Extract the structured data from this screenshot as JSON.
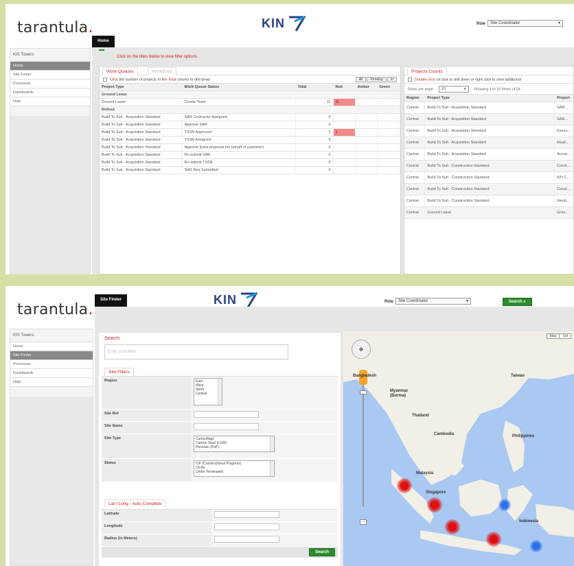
{
  "brand": {
    "logo": "tarantula",
    "logo_dot": ".",
    "kin": "KIN"
  },
  "screen1": {
    "role_label": "Role",
    "role_value": "Site Coordinator",
    "tab": "Home",
    "sidebar": {
      "title": "KIS Towers",
      "items": [
        "Home",
        "Site Finder",
        "Processes",
        "Dashboards",
        "Help"
      ]
    },
    "hint": "Click on the titles below to view filter options.",
    "work_queues": {
      "tabs": [
        "Work Queues",
        "Workflows"
      ],
      "note_prefix": "Click",
      "note_mid": " the number of projects in the ",
      "note_red": "Total",
      "note_suffix": " column to drill down",
      "buttons": [
        "All",
        "Pending",
        "In"
      ],
      "columns": [
        "Project Type",
        "Work Queue Status",
        "Total",
        "Red",
        "Amber",
        "Green"
      ],
      "groups": [
        {
          "name": "Ground Lease",
          "rows": [
            [
              "Ground Lease",
              "Create Team",
              "11",
              "11",
              "",
              ""
            ]
          ]
        },
        {
          "name": "Rollout",
          "rows": [
            [
              "Build To Suit - Acquisition Standard",
              "SAR Contractor Assigned",
              "0",
              "",
              "",
              ""
            ],
            [
              "Build To Suit - Acquisition Standard",
              "Approve SAR",
              "0",
              "",
              "",
              ""
            ],
            [
              "Build To Suit - Acquisition Standard",
              "TSSR Approved",
              "1",
              "1",
              "",
              ""
            ],
            [
              "Build To Suit - Acquisition Standard",
              "TSSR Assigned",
              "0",
              "",
              "",
              ""
            ],
            [
              "Build To Suit - Acquisition Standard",
              "Approve Extra proposal (on behalf of customer)",
              "0",
              "",
              "",
              ""
            ],
            [
              "Build To Suit - Acquisition Standard",
              "Re-submit SAR",
              "0",
              "",
              "",
              ""
            ],
            [
              "Build To Suit - Acquisition Standard",
              "Re-submit TSSR",
              "0",
              "",
              "",
              ""
            ],
            [
              "Build To Suit - Acquisition Standard",
              "SAR Req Submitted",
              "0",
              "",
              "",
              ""
            ]
          ]
        }
      ]
    },
    "projects_counts": {
      "tab": "Projects Counts",
      "note_red": "Double-click",
      "note_rest": " on task to drill down or right-click to view additional",
      "rows_label": "Rows per page",
      "rows_value": "10",
      "showing": "Showing 1 to 10 items of 54",
      "columns": [
        "Region",
        "Project Type",
        "Project"
      ],
      "rows": [
        [
          "Central",
          "Build To Suit - Acquisition Standard",
          "SAR..."
        ],
        [
          "Central",
          "Build To Suit - Acquisition Standard",
          "SAR..."
        ],
        [
          "Central",
          "Build To Suit - Acquisition Standard",
          "Execu..."
        ],
        [
          "Central",
          "Build To Suit - Acquisition Standard",
          "Reall..."
        ],
        [
          "Central",
          "Build To Suit - Acquisition Standard",
          "Accep..."
        ],
        [
          "Central",
          "Build To Suit - Construction Standard",
          "Const..."
        ],
        [
          "Central",
          "Build To Suit - Construction Standard",
          "KPI C..."
        ],
        [
          "Central",
          "Build To Suit - Construction Standard",
          "Const..."
        ],
        [
          "Central",
          "Build To Suit - Construction Standard",
          "Identi..."
        ],
        [
          "Central",
          "Ground Lease",
          "Grou..."
        ]
      ]
    }
  },
  "screen2": {
    "role_label": "Role",
    "role_value": "Site Coordinator",
    "search_btn": "Search",
    "tab": "Site Finder",
    "sidebar": {
      "title": "KIS Towers",
      "items": [
        "Home",
        "Site Finder",
        "Processes",
        "Dashboards",
        "Help"
      ]
    },
    "search": {
      "title": "Search",
      "placeholder": "Enter a location"
    },
    "site_filters": {
      "tab": "Site Filters",
      "region_label": "Region",
      "region_options": [
        "East",
        "West",
        "North",
        "Central"
      ],
      "site_ref_label": "Site Ref",
      "site_name_label": "Site Name",
      "site_type_label": "Site Type",
      "site_type_options": [
        "Camouflage",
        "Carbon Steel (CoW)",
        "Penosan (PoP)"
      ],
      "status_label": "Status",
      "status_options": [
        "C/F (Constructional Progress)",
        "On Air",
        "Under Terminated"
      ]
    },
    "latlong": {
      "title": "Lat / Long - Auto Complete",
      "latitude": "Latitude",
      "longitude": "Longitude",
      "radius": "Radius (in Meters)",
      "search_btn": "Search"
    },
    "map": {
      "type_map": "Map",
      "type_sat": "Sat",
      "labels": [
        "Bangladesh",
        "Myanmar (Burma)",
        "Taiwan",
        "Thailand",
        "Cambodia",
        "Philippines",
        "Malaysia",
        "Singapore",
        "Indonesia"
      ],
      "colors": {
        "water": "#a9c8f2",
        "land": "#f2efe6",
        "red_cluster": "#e01010",
        "blue_cluster": "#2a6fe8"
      }
    }
  }
}
